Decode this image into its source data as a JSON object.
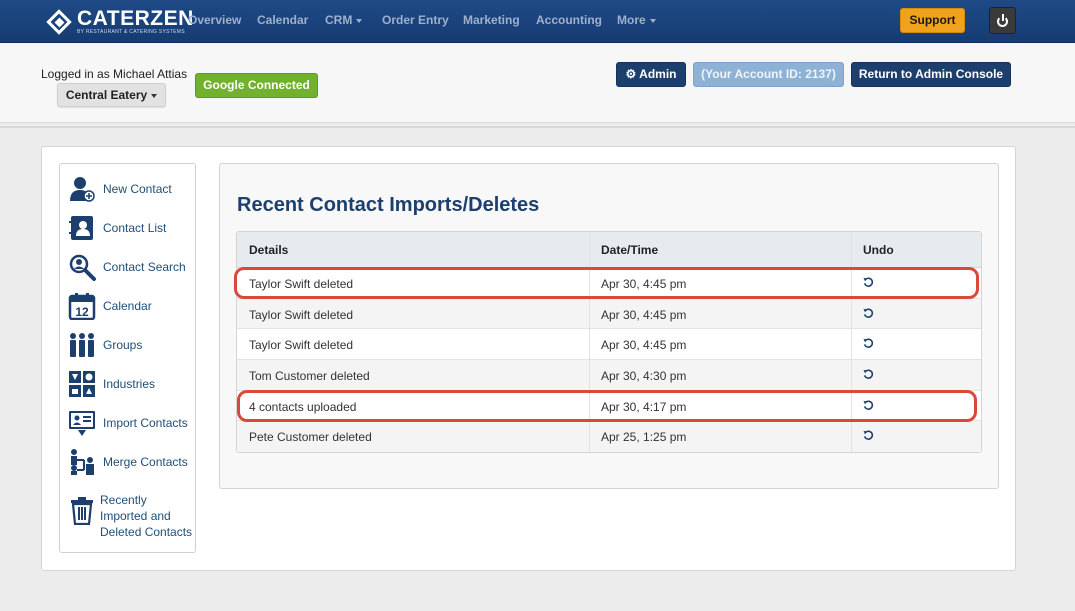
{
  "brand": {
    "name": "CATERZEN",
    "tagline": "BY RESTAURANT & CATERING SYSTEMS"
  },
  "nav": {
    "items": [
      {
        "label": "Overview"
      },
      {
        "label": "Calendar"
      },
      {
        "label": "CRM"
      },
      {
        "label": "Order Entry"
      },
      {
        "label": "Marketing"
      },
      {
        "label": "Accounting"
      },
      {
        "label": "More"
      }
    ],
    "support_label": "Support"
  },
  "account": {
    "logged_in_text": "Logged in as Michael Attias",
    "location_label": "Central Eatery",
    "google_label": "Google Connected",
    "admin_label": "Admin",
    "account_id_label": "(Your Account ID: 2137)",
    "return_label": "Return to Admin Console"
  },
  "sidebar": {
    "items": [
      {
        "label": "New Contact",
        "icon": "new-contact-icon"
      },
      {
        "label": "Contact List",
        "icon": "contact-list-icon"
      },
      {
        "label": "Contact Search",
        "icon": "search-icon"
      },
      {
        "label": "Calendar",
        "icon": "calendar-icon"
      },
      {
        "label": "Groups",
        "icon": "groups-icon"
      },
      {
        "label": "Industries",
        "icon": "industries-icon"
      },
      {
        "label": "Import Contacts",
        "icon": "import-icon"
      },
      {
        "label": "Merge Contacts",
        "icon": "merge-icon"
      },
      {
        "label": "Recently Imported and Deleted Contacts",
        "icon": "trash-icon"
      }
    ],
    "calendar_day": "12"
  },
  "main": {
    "title": "Recent Contact Imports/Deletes",
    "columns": [
      "Details",
      "Date/Time",
      "Undo"
    ],
    "rows": [
      {
        "details": "Taylor Swift deleted",
        "datetime": "Apr 30, 4:45 pm"
      },
      {
        "details": "Taylor Swift deleted",
        "datetime": "Apr 30, 4:45 pm"
      },
      {
        "details": "Taylor Swift deleted",
        "datetime": "Apr 30, 4:45 pm"
      },
      {
        "details": "Tom Customer deleted",
        "datetime": "Apr 30, 4:30 pm"
      },
      {
        "details": "4 contacts uploaded",
        "datetime": "Apr 30, 4:17 pm"
      },
      {
        "details": "Pete Customer deleted",
        "datetime": "Apr 25, 1:25 pm"
      }
    ]
  },
  "colors": {
    "nav_bg": "#1f4a86",
    "primary": "#1c3f6e",
    "support": "#f0a21c",
    "google": "#72b12e",
    "highlight": "#d9493a"
  }
}
